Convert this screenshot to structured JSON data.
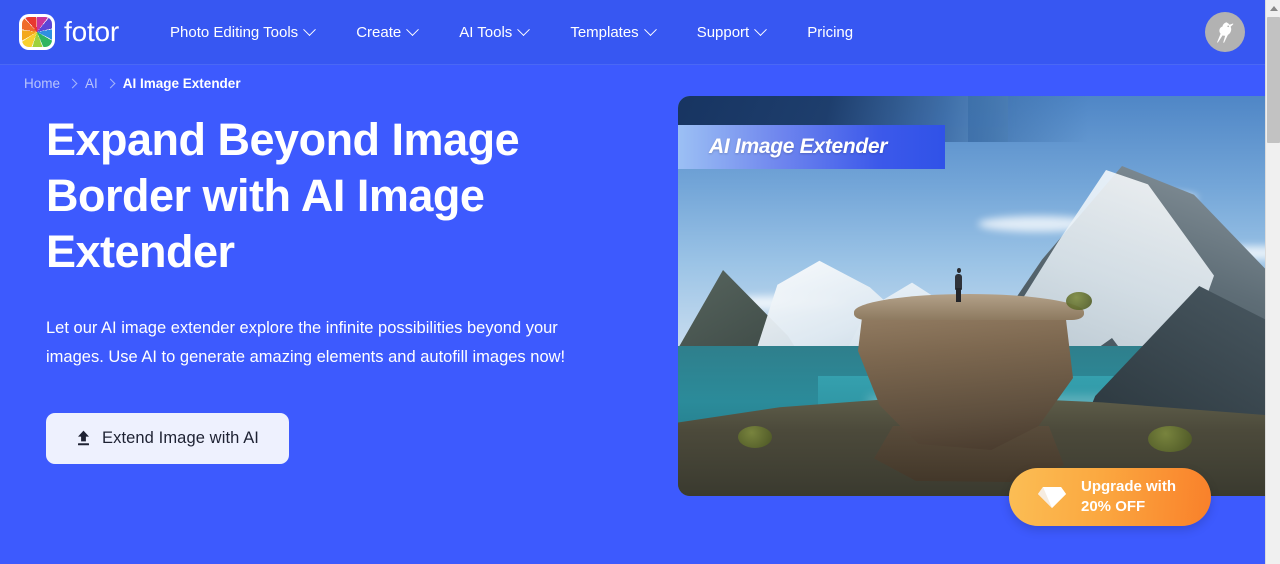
{
  "brand": {
    "name": "fotor",
    "logo_icon": "fotor-color-wheel-logo"
  },
  "nav": {
    "items": [
      {
        "label": "Photo Editing Tools",
        "has_dropdown": true
      },
      {
        "label": "Create",
        "has_dropdown": true
      },
      {
        "label": "AI Tools",
        "has_dropdown": true
      },
      {
        "label": "Templates",
        "has_dropdown": true
      },
      {
        "label": "Support",
        "has_dropdown": true
      },
      {
        "label": "Pricing",
        "has_dropdown": false
      }
    ],
    "avatar_icon": "bird-avatar-icon"
  },
  "breadcrumb": {
    "home": "Home",
    "category": "AI",
    "current": "AI Image Extender",
    "separator_icon": "chevron-right-icon"
  },
  "hero": {
    "title": "Expand Beyond Image Border with AI Image Extender",
    "subtitle": "Let our AI image extender explore the infinite possibilities beyond your images. Use AI to generate amazing elements and autofill images now!",
    "cta_label": "Extend Image with AI",
    "cta_icon": "upload-arrow-icon",
    "image_badge": "AI Image Extender",
    "image_alt": "Person standing on a cliff boulder overlooking a turquoise fjord with snowy mountains"
  },
  "upgrade": {
    "line1": "Upgrade with",
    "line2": "20% OFF",
    "icon": "diamond-gem-icon"
  },
  "scrollbar": {
    "up_arrow_icon": "scroll-up-arrow-icon"
  },
  "colors": {
    "page_background": "#3d5afe",
    "navbar_background": "#3757f2",
    "cta_background": "#eef1fe",
    "cta_text": "#1e2233",
    "breadcrumb_muted": "#b9c5fb",
    "upgrade_gradient_start": "#fbbe55",
    "upgrade_gradient_end": "#f9802a",
    "badge_gradient_start": "#9cc0f4",
    "badge_gradient_end": "#3052e8"
  }
}
